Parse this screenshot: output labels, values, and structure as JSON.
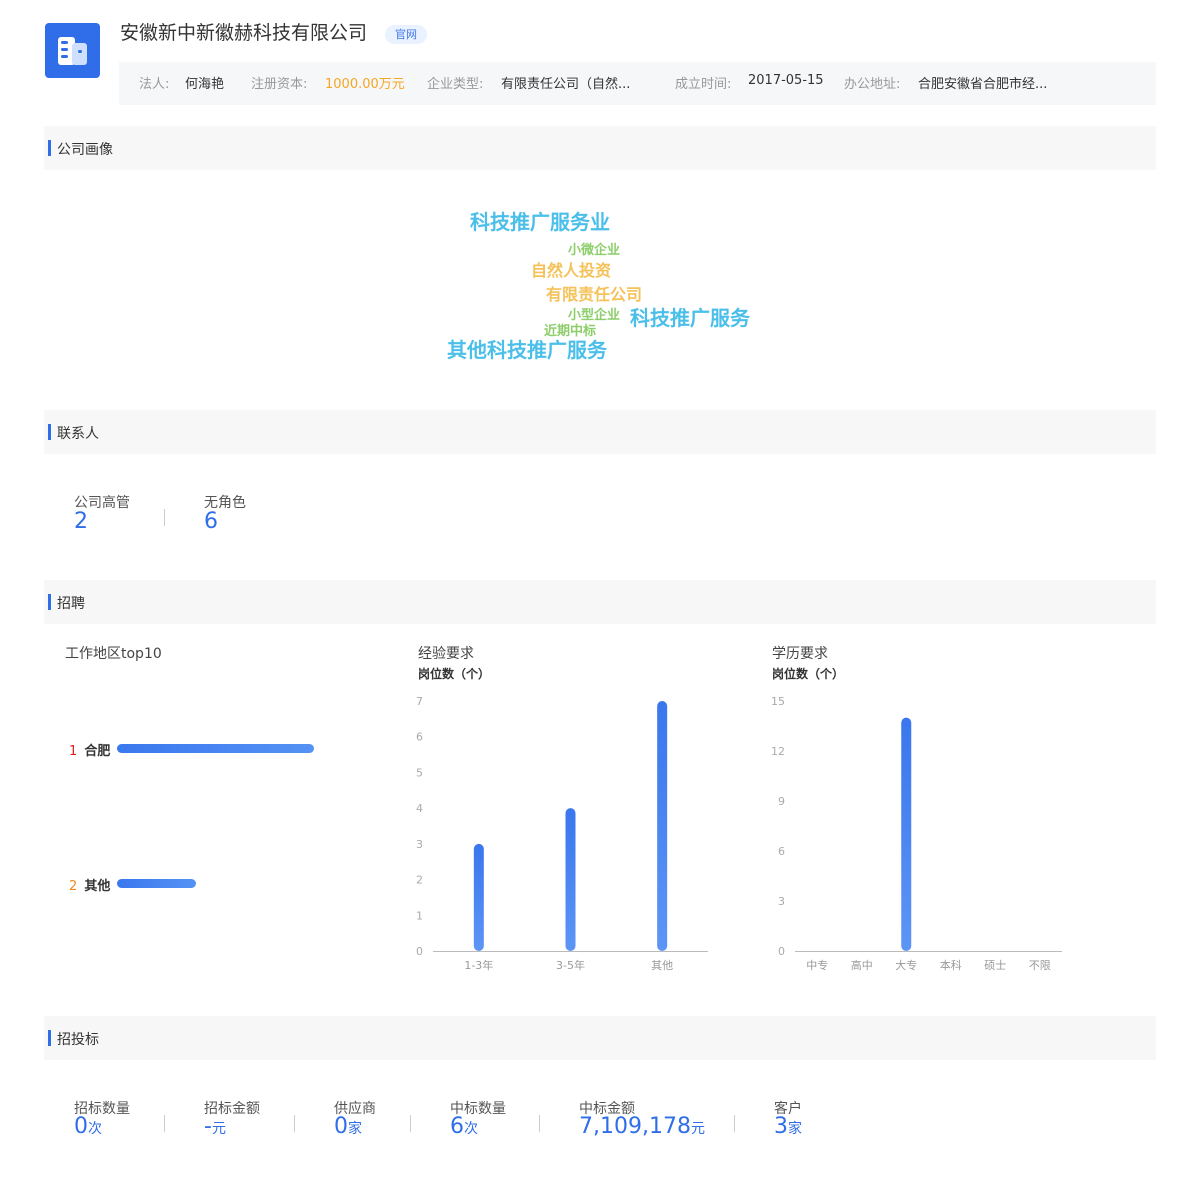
{
  "header": {
    "company_name": "安徽新中新徽赫科技有限公司",
    "site_badge": "官网",
    "info": [
      {
        "label": "法人:",
        "value": "何海艳"
      },
      {
        "label": "注册资本:",
        "value": "1000.00万元"
      },
      {
        "label": "企业类型:",
        "value": "有限责任公司（自然..."
      },
      {
        "label": "成立时间:",
        "value": "2017-05-15"
      },
      {
        "label": "办公地址:",
        "value": "合肥安徽省合肥市经..."
      }
    ]
  },
  "sections": {
    "portrait": "公司画像",
    "contacts": "联系人",
    "recruit": "招聘",
    "bidding": "招投标"
  },
  "word_cloud": [
    {
      "text": "科技推广服务业",
      "color": "#4bbfea"
    },
    {
      "text": "小微企业",
      "color": "#8dce6a"
    },
    {
      "text": "自然人投资",
      "color": "#f5c25a"
    },
    {
      "text": "有限责任公司",
      "color": "#f5c25a"
    },
    {
      "text": "小型企业",
      "color": "#8dce6a"
    },
    {
      "text": "科技推广服务",
      "color": "#4bbfea"
    },
    {
      "text": "近期中标",
      "color": "#8dce6a"
    },
    {
      "text": "其他科技推广服务",
      "color": "#4bbfea"
    }
  ],
  "contacts": [
    {
      "label": "公司高管",
      "value": "2"
    },
    {
      "label": "无角色",
      "value": "6"
    }
  ],
  "recruit": {
    "region_title": "工作地区top10",
    "regions": [
      {
        "rank": "1",
        "name": "合肥",
        "value": 1.0,
        "rank_color": "#e02020"
      },
      {
        "rank": "2",
        "name": "其他",
        "value": 0.4,
        "rank_color": "#f08a1c"
      }
    ],
    "experience_title": "经验要求",
    "education_title": "学历要求"
  },
  "chart_data": [
    {
      "type": "bar",
      "title": "经验要求",
      "ylabel": "岗位数（个）",
      "categories": [
        "1-3年",
        "3-5年",
        "其他"
      ],
      "values": [
        3,
        4,
        7
      ],
      "ylim": [
        0,
        7
      ],
      "yticks": [
        0,
        1,
        2,
        3,
        4,
        5,
        6,
        7
      ],
      "grid": false
    },
    {
      "type": "bar",
      "title": "学历要求",
      "ylabel": "岗位数（个）",
      "categories": [
        "中专",
        "高中",
        "大专",
        "本科",
        "硕士",
        "不限"
      ],
      "values": [
        0,
        0,
        14,
        0,
        0,
        0
      ],
      "ylim": [
        0,
        15
      ],
      "yticks": [
        0,
        3,
        6,
        9,
        12,
        15
      ],
      "grid": false
    }
  ],
  "bidding": [
    {
      "label": "招标数量",
      "value": "0",
      "unit": "次"
    },
    {
      "label": "招标金额",
      "value": "-",
      "unit": "元"
    },
    {
      "label": "供应商",
      "value": "0",
      "unit": "家"
    },
    {
      "label": "中标数量",
      "value": "6",
      "unit": "次"
    },
    {
      "label": "中标金额",
      "value": "7,109,178",
      "unit": "元"
    },
    {
      "label": "客户",
      "value": "3",
      "unit": "家"
    }
  ]
}
